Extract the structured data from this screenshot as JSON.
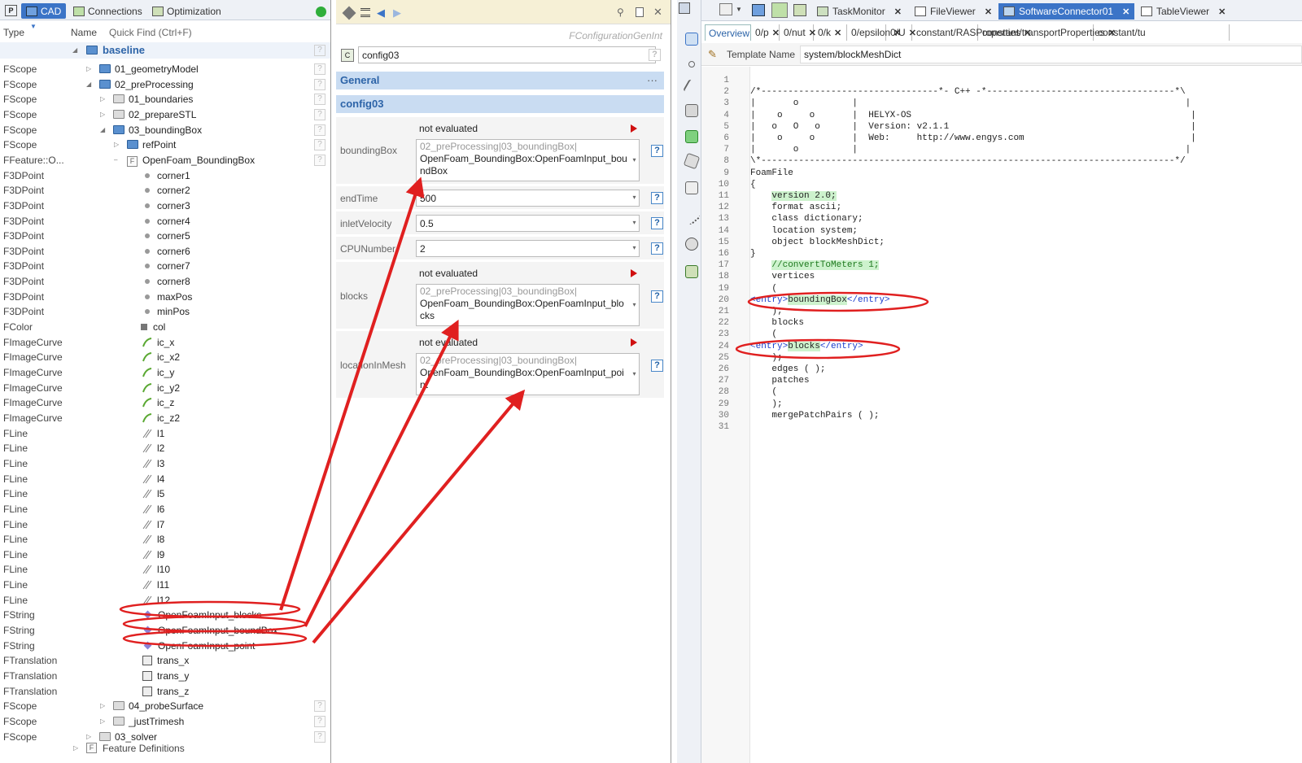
{
  "left": {
    "tabs": [
      "CAD",
      "Connections",
      "Optimization"
    ],
    "header": {
      "type": "Type",
      "name": "Name",
      "quick_find": "Quick Find (Ctrl+F)"
    },
    "root": "baseline",
    "rows": [
      {
        "type": "FScope",
        "name": "01_geometryModel"
      },
      {
        "type": "FScope",
        "name": "02_preProcessing"
      },
      {
        "type": "FScope",
        "name": "01_boundaries"
      },
      {
        "type": "FScope",
        "name": "02_prepareSTL"
      },
      {
        "type": "FScope",
        "name": "03_boundingBox"
      },
      {
        "type": "FScope",
        "name": "refPoint"
      },
      {
        "type": "FFeature::O...",
        "name": "OpenFoam_BoundingBox"
      },
      {
        "type": "F3DPoint",
        "name": "corner1"
      },
      {
        "type": "F3DPoint",
        "name": "corner2"
      },
      {
        "type": "F3DPoint",
        "name": "corner3"
      },
      {
        "type": "F3DPoint",
        "name": "corner4"
      },
      {
        "type": "F3DPoint",
        "name": "corner5"
      },
      {
        "type": "F3DPoint",
        "name": "corner6"
      },
      {
        "type": "F3DPoint",
        "name": "corner7"
      },
      {
        "type": "F3DPoint",
        "name": "corner8"
      },
      {
        "type": "F3DPoint",
        "name": "maxPos"
      },
      {
        "type": "F3DPoint",
        "name": "minPos"
      },
      {
        "type": "FColor",
        "name": "col"
      },
      {
        "type": "FImageCurve",
        "name": "ic_x"
      },
      {
        "type": "FImageCurve",
        "name": "ic_x2"
      },
      {
        "type": "FImageCurve",
        "name": "ic_y"
      },
      {
        "type": "FImageCurve",
        "name": "ic_y2"
      },
      {
        "type": "FImageCurve",
        "name": "ic_z"
      },
      {
        "type": "FImageCurve",
        "name": "ic_z2"
      },
      {
        "type": "FLine",
        "name": "l1"
      },
      {
        "type": "FLine",
        "name": "l2"
      },
      {
        "type": "FLine",
        "name": "l3"
      },
      {
        "type": "FLine",
        "name": "l4"
      },
      {
        "type": "FLine",
        "name": "l5"
      },
      {
        "type": "FLine",
        "name": "l6"
      },
      {
        "type": "FLine",
        "name": "l7"
      },
      {
        "type": "FLine",
        "name": "l8"
      },
      {
        "type": "FLine",
        "name": "l9"
      },
      {
        "type": "FLine",
        "name": "l10"
      },
      {
        "type": "FLine",
        "name": "l11"
      },
      {
        "type": "FLine",
        "name": "l12"
      },
      {
        "type": "FString",
        "name": "OpenFoamInput_blocks"
      },
      {
        "type": "FString",
        "name": "OpenFoamInput_boundBox"
      },
      {
        "type": "FString",
        "name": "OpenFoamInput_point"
      },
      {
        "type": "FTranslation",
        "name": "trans_x"
      },
      {
        "type": "FTranslation",
        "name": "trans_y"
      },
      {
        "type": "FTranslation",
        "name": "trans_z"
      },
      {
        "type": "FScope",
        "name": "04_probeSurface"
      },
      {
        "type": "FScope",
        "name": "_justTrimesh"
      },
      {
        "type": "FScope",
        "name": "03_solver"
      }
    ],
    "footer": "Feature Definitions"
  },
  "mid": {
    "class_name": "FConfigurationGenInt",
    "config_name": "config03",
    "sections": {
      "general": "General",
      "config": "config03"
    },
    "not_evaluated": "not evaluated",
    "params": {
      "bounding_box": {
        "label": "boundingBox",
        "path": "02_preProcessing|03_boundingBox|",
        "line1": "OpenFoam_BoundingBox:OpenFoamInput_bou",
        "line2": "ndBox"
      },
      "end_time": {
        "label": "endTime",
        "value": "500"
      },
      "inlet_velocity": {
        "label": "inletVelocity",
        "value": "0.5"
      },
      "cpu_number": {
        "label": "CPUNumber",
        "value": "2"
      },
      "blocks": {
        "label": "blocks",
        "path": "02_preProcessing|03_boundingBox|",
        "line1": "OpenFoam_BoundingBox:OpenFoamInput_blo",
        "line2": "cks"
      },
      "location_in_mesh": {
        "label": "locationInMesh",
        "path": "02_preProcessing|03_boundingBox|",
        "line1": "OpenFoam_BoundingBox:OpenFoamInput_poi",
        "line2": "nt"
      }
    }
  },
  "right": {
    "tabs": [
      "TaskMonitor",
      "FileViewer",
      "SoftwareConnector01",
      "TableViewer"
    ],
    "active_tab": "SoftwareConnector01",
    "subtabs": [
      "Overview",
      "0/p",
      "0/nut",
      "0/k",
      "0/epsilon",
      "0/U",
      "constant/RASProperties",
      "constant/transportProperties",
      "constant/tu"
    ],
    "template_label": "Template Name",
    "template_value": "system/blockMeshDict",
    "line_numbers": "1\n2\n3\n4\n5\n6\n7\n8\n9\n10\n11\n12\n13\n14\n15\n16\n17\n18\n19\n20\n21\n22\n23\n24\n25\n26\n27\n28\n29\n30\n31",
    "code": {
      "l1": "/*---------------------------------*- C++ -*-----------------------------------*\\",
      "l2": "|       o          |                                                             |",
      "l3": "|    o     o       |  HELYX-OS                                                    |",
      "l4": "|   o   O   o      |  Version: v2.1.1                                             |",
      "l5": "|    o     o       |  Web:     http://www.engys.com                               |",
      "l6": "|       o          |                                                             |",
      "l7": "\\*-----------------------------------------------------------------------------*/",
      "l8": "FoamFile",
      "l9": "{",
      "l10": "version 2.0;",
      "l11": "    format ascii;",
      "l12": "    class dictionary;",
      "l13": "    location system;",
      "l14": "    object blockMeshDict;",
      "l15": "}",
      "l16": "",
      "l17": "//convertToMeters 1;",
      "l18": "    vertices",
      "l19": "    (",
      "l20a": "<entry>",
      "l20b": "boundingBox",
      "l20c": "</entry>",
      "l21": "    );",
      "l22": "    blocks",
      "l23": "    (",
      "l24a": "<entry>",
      "l24b": "blocks",
      "l24c": "</entry>",
      "l25": "    );",
      "l26": "    edges ( );",
      "l27": "    patches",
      "l28": "    (",
      "l29": "",
      "l30": "    );",
      "l31": "    mergePatchPairs ( );"
    }
  },
  "colors": {
    "accent": "#3b74c7",
    "annotation": "#e02020",
    "section_bg": "#c9dcf2"
  }
}
